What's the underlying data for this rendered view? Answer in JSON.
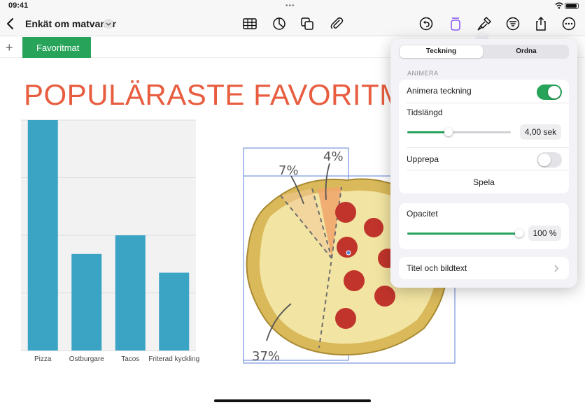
{
  "status_bar": {
    "time": "09:41"
  },
  "toolbar": {
    "back_label": "",
    "title": "Enkät om matvanor",
    "icons": [
      "table-icon",
      "chart-icon",
      "shapes-icon",
      "paperclip-icon",
      "undo-icon",
      "presenter-icon",
      "format-brush-icon",
      "filter-icon",
      "share-icon",
      "more-icon"
    ],
    "accent": "#27a35a"
  },
  "sheets": {
    "add_label": "+",
    "tabs": [
      {
        "label": "Favoritmat",
        "active": true
      }
    ]
  },
  "canvas": {
    "title": "POPULÄRASTE FAVORITMAT",
    "title_color": "#e85d3f"
  },
  "chart_data": {
    "type": "bar",
    "categories": [
      "Pizza",
      "Ostburgare",
      "Tacos",
      "Friterad kyckling"
    ],
    "values": [
      37,
      15.5,
      18.5,
      12.5
    ],
    "ylim": [
      0,
      37
    ],
    "grid": true,
    "bar_color": "#3ba3c4",
    "title": "",
    "xlabel": "",
    "ylabel": ""
  },
  "pizza_image": {
    "annotations": [
      "7%",
      "4%",
      "37%"
    ]
  },
  "popover": {
    "segments": [
      "Teckning",
      "Ordna"
    ],
    "selected_segment": "Teckning",
    "section_header": "ANIMERA",
    "animate_drawing": {
      "label": "Animera teckning",
      "on": true
    },
    "duration": {
      "label": "Tidslängd",
      "value": "4,00 sek",
      "level": 0.4
    },
    "repeat": {
      "label": "Upprepa",
      "on": false
    },
    "play_label": "Spela",
    "opacity": {
      "label": "Opacitet",
      "value": "100 %",
      "level": 1.0
    },
    "caption_row": {
      "label": "Titel och bildtext"
    }
  }
}
